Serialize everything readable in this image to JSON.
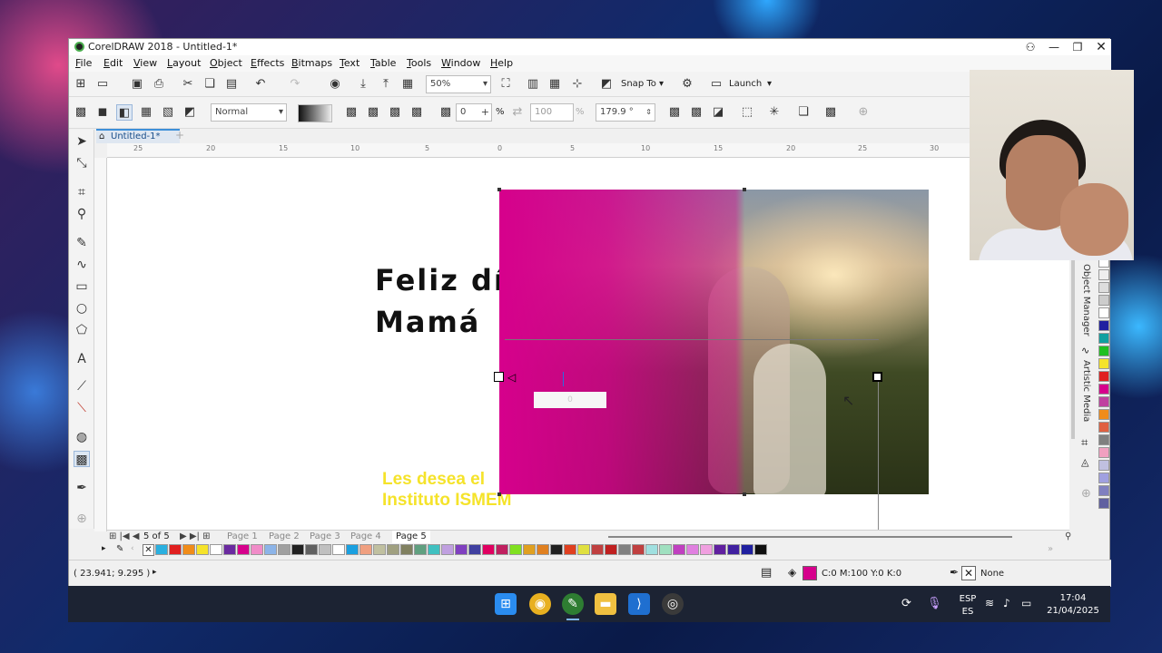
{
  "window": {
    "title": "CorelDRAW 2018 - Untitled-1*"
  },
  "menu": [
    "File",
    "Edit",
    "View",
    "Layout",
    "Object",
    "Effects",
    "Bitmaps",
    "Text",
    "Table",
    "Tools",
    "Window",
    "Help"
  ],
  "standard_toolbar": {
    "zoom": "50%",
    "snap_to": "Snap To",
    "launch": "Launch"
  },
  "property_bar": {
    "merge_mode": "Normal",
    "node_value": "0",
    "transparency_value": "100",
    "percent_symbol": "%",
    "angle": "179.9 °"
  },
  "document_tab": "Untitled-1*",
  "ruler": {
    "h_ticks": [
      "25",
      "20",
      "15",
      "10",
      "5",
      "0",
      "5",
      "10",
      "15",
      "20",
      "25",
      "30"
    ]
  },
  "artwork": {
    "heading": "Feliz día\nMamá",
    "subtext": "Les desea el\nInstituto ISMEM",
    "transparency_readout": "0",
    "overlay_color": "#d6008c",
    "subtext_color": "#f5e32a"
  },
  "dockers": {
    "object_manager": "Object Manager",
    "artistic_media": "Artistic Media"
  },
  "page_nav": {
    "counter": "5 of 5",
    "pages": [
      "Page 1",
      "Page 2",
      "Page 3",
      "Page 4",
      "Page 5"
    ],
    "active_page": "Page 5"
  },
  "status": {
    "coordinates": "( 23.941; 9.295 )",
    "fill_info": "C:0 M:100 Y:0 K:0",
    "fill_color": "#d6008c",
    "outline_info": "None"
  },
  "taskbar": {
    "language_top": "ESP",
    "language_bottom": "ES",
    "time": "17:04",
    "date": "21/04/2025"
  },
  "palette": [
    "#2ab0e0",
    "#e02020",
    "#f08c1a",
    "#f5e32a",
    "#ffffff",
    "#6a2aa0",
    "#d6008c",
    "#f08cc8",
    "#8cb4e8",
    "#a0a0a0",
    "#202020",
    "#606060",
    "#c0c0c0",
    "#ffffff",
    "#1aa0e0",
    "#f0a080",
    "#c0c0a0",
    "#a0a080",
    "#808060",
    "#60a080",
    "#40c0c0",
    "#c0a0e0",
    "#8040c0",
    "#4040a0",
    "#e00060",
    "#c02060",
    "#80e020",
    "#e0a020",
    "#e08020",
    "#202020",
    "#e04020",
    "#e0e040",
    "#c04040",
    "#c02020",
    "#808080",
    "#c04040",
    "#a0e0e0",
    "#a0e0c0",
    "#c040c0",
    "#e080e0",
    "#f0a0e0",
    "#6020a0",
    "#4020a0",
    "#2020a0",
    "#101010"
  ],
  "palette_v": [
    "#ffffff",
    "#eeeeee",
    "#dddddd",
    "#cccccc",
    "#ffffff",
    "#2020a0",
    "#10a0a0",
    "#20c020",
    "#f5e32a",
    "#e02020",
    "#d6008c",
    "#c040a0",
    "#f08c1a",
    "#e06040",
    "#808080",
    "#f0a0c0",
    "#c0c0e0",
    "#a0a0e0",
    "#8080c0",
    "#6060a0"
  ]
}
